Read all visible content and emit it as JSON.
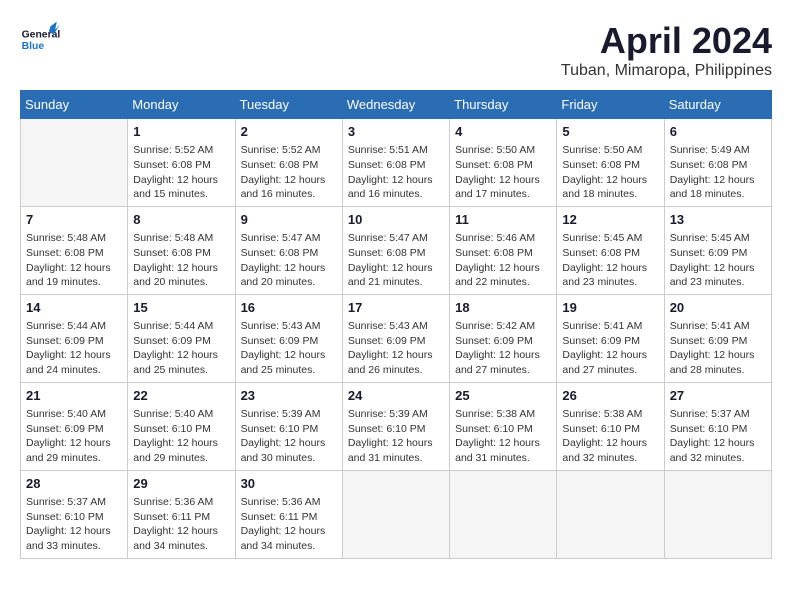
{
  "header": {
    "logo_general": "General",
    "logo_blue": "Blue",
    "month_year": "April 2024",
    "location": "Tuban, Mimaropa, Philippines"
  },
  "columns": [
    "Sunday",
    "Monday",
    "Tuesday",
    "Wednesday",
    "Thursday",
    "Friday",
    "Saturday"
  ],
  "weeks": [
    [
      {
        "day": "",
        "info": ""
      },
      {
        "day": "1",
        "info": "Sunrise: 5:52 AM\nSunset: 6:08 PM\nDaylight: 12 hours\nand 15 minutes."
      },
      {
        "day": "2",
        "info": "Sunrise: 5:52 AM\nSunset: 6:08 PM\nDaylight: 12 hours\nand 16 minutes."
      },
      {
        "day": "3",
        "info": "Sunrise: 5:51 AM\nSunset: 6:08 PM\nDaylight: 12 hours\nand 16 minutes."
      },
      {
        "day": "4",
        "info": "Sunrise: 5:50 AM\nSunset: 6:08 PM\nDaylight: 12 hours\nand 17 minutes."
      },
      {
        "day": "5",
        "info": "Sunrise: 5:50 AM\nSunset: 6:08 PM\nDaylight: 12 hours\nand 18 minutes."
      },
      {
        "day": "6",
        "info": "Sunrise: 5:49 AM\nSunset: 6:08 PM\nDaylight: 12 hours\nand 18 minutes."
      }
    ],
    [
      {
        "day": "7",
        "info": "Sunrise: 5:48 AM\nSunset: 6:08 PM\nDaylight: 12 hours\nand 19 minutes."
      },
      {
        "day": "8",
        "info": "Sunrise: 5:48 AM\nSunset: 6:08 PM\nDaylight: 12 hours\nand 20 minutes."
      },
      {
        "day": "9",
        "info": "Sunrise: 5:47 AM\nSunset: 6:08 PM\nDaylight: 12 hours\nand 20 minutes."
      },
      {
        "day": "10",
        "info": "Sunrise: 5:47 AM\nSunset: 6:08 PM\nDaylight: 12 hours\nand 21 minutes."
      },
      {
        "day": "11",
        "info": "Sunrise: 5:46 AM\nSunset: 6:08 PM\nDaylight: 12 hours\nand 22 minutes."
      },
      {
        "day": "12",
        "info": "Sunrise: 5:45 AM\nSunset: 6:08 PM\nDaylight: 12 hours\nand 23 minutes."
      },
      {
        "day": "13",
        "info": "Sunrise: 5:45 AM\nSunset: 6:09 PM\nDaylight: 12 hours\nand 23 minutes."
      }
    ],
    [
      {
        "day": "14",
        "info": "Sunrise: 5:44 AM\nSunset: 6:09 PM\nDaylight: 12 hours\nand 24 minutes."
      },
      {
        "day": "15",
        "info": "Sunrise: 5:44 AM\nSunset: 6:09 PM\nDaylight: 12 hours\nand 25 minutes."
      },
      {
        "day": "16",
        "info": "Sunrise: 5:43 AM\nSunset: 6:09 PM\nDaylight: 12 hours\nand 25 minutes."
      },
      {
        "day": "17",
        "info": "Sunrise: 5:43 AM\nSunset: 6:09 PM\nDaylight: 12 hours\nand 26 minutes."
      },
      {
        "day": "18",
        "info": "Sunrise: 5:42 AM\nSunset: 6:09 PM\nDaylight: 12 hours\nand 27 minutes."
      },
      {
        "day": "19",
        "info": "Sunrise: 5:41 AM\nSunset: 6:09 PM\nDaylight: 12 hours\nand 27 minutes."
      },
      {
        "day": "20",
        "info": "Sunrise: 5:41 AM\nSunset: 6:09 PM\nDaylight: 12 hours\nand 28 minutes."
      }
    ],
    [
      {
        "day": "21",
        "info": "Sunrise: 5:40 AM\nSunset: 6:09 PM\nDaylight: 12 hours\nand 29 minutes."
      },
      {
        "day": "22",
        "info": "Sunrise: 5:40 AM\nSunset: 6:10 PM\nDaylight: 12 hours\nand 29 minutes."
      },
      {
        "day": "23",
        "info": "Sunrise: 5:39 AM\nSunset: 6:10 PM\nDaylight: 12 hours\nand 30 minutes."
      },
      {
        "day": "24",
        "info": "Sunrise: 5:39 AM\nSunset: 6:10 PM\nDaylight: 12 hours\nand 31 minutes."
      },
      {
        "day": "25",
        "info": "Sunrise: 5:38 AM\nSunset: 6:10 PM\nDaylight: 12 hours\nand 31 minutes."
      },
      {
        "day": "26",
        "info": "Sunrise: 5:38 AM\nSunset: 6:10 PM\nDaylight: 12 hours\nand 32 minutes."
      },
      {
        "day": "27",
        "info": "Sunrise: 5:37 AM\nSunset: 6:10 PM\nDaylight: 12 hours\nand 32 minutes."
      }
    ],
    [
      {
        "day": "28",
        "info": "Sunrise: 5:37 AM\nSunset: 6:10 PM\nDaylight: 12 hours\nand 33 minutes."
      },
      {
        "day": "29",
        "info": "Sunrise: 5:36 AM\nSunset: 6:11 PM\nDaylight: 12 hours\nand 34 minutes."
      },
      {
        "day": "30",
        "info": "Sunrise: 5:36 AM\nSunset: 6:11 PM\nDaylight: 12 hours\nand 34 minutes."
      },
      {
        "day": "",
        "info": ""
      },
      {
        "day": "",
        "info": ""
      },
      {
        "day": "",
        "info": ""
      },
      {
        "day": "",
        "info": ""
      }
    ]
  ]
}
